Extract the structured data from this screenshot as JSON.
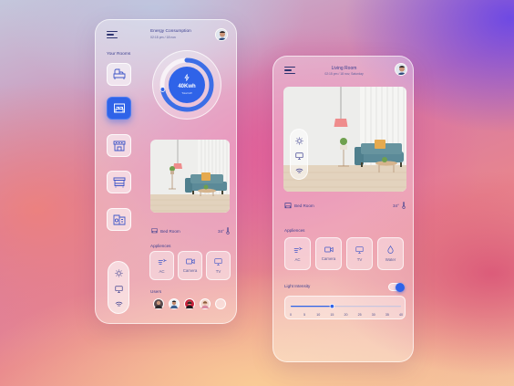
{
  "left_phone": {
    "rooms_title": "Your Rooms",
    "rooms": [
      {
        "icon": "couch-icon",
        "active": false
      },
      {
        "icon": "bed-icon",
        "active": true
      },
      {
        "icon": "kitchen-icon",
        "active": false
      },
      {
        "icon": "bath-icon",
        "active": false
      },
      {
        "icon": "laundry-icon",
        "active": false
      }
    ],
    "energy": {
      "title": "Energy Consumption",
      "subtitle": "02:15 pm / 18 nov",
      "value": "40Kwh",
      "caption": "Total kW",
      "level": 0.72
    },
    "room": {
      "name": "Bed Room",
      "temp": "34°"
    },
    "appliances_title": "Appliences",
    "appliances": [
      {
        "label": "AC",
        "icon": "ac-icon"
      },
      {
        "label": "Camera",
        "icon": "camera-icon"
      },
      {
        "label": "TV",
        "icon": "tv-icon"
      }
    ],
    "users_title": "Users",
    "controls": [
      "sun-icon",
      "monitor-icon",
      "wifi-icon"
    ]
  },
  "right_phone": {
    "title": "Living Room",
    "subtitle": "02:15 pm / 18 nov, Saturday",
    "room": {
      "name": "Bed Room",
      "temp": "34°"
    },
    "appliances_title": "Appliences",
    "appliances": [
      {
        "label": "AC",
        "icon": "ac-icon"
      },
      {
        "label": "Camera",
        "icon": "camera-icon"
      },
      {
        "label": "TV",
        "icon": "tv-icon"
      },
      {
        "label": "Water",
        "icon": "water-drop-icon"
      }
    ],
    "light_title": "Light Intensity",
    "light_toggle_on": true,
    "slider": {
      "value": 15,
      "ticks": [
        "0",
        "5",
        "10",
        "15",
        "20",
        "25",
        "30",
        "35",
        "40"
      ]
    },
    "controls": [
      "sun-icon",
      "monitor-icon",
      "wifi-icon"
    ]
  },
  "colors": {
    "accent": "#2f63e8",
    "text": "#3c3f8f",
    "lamp": "#ef8c8c",
    "sofa": "#5b8a98"
  }
}
